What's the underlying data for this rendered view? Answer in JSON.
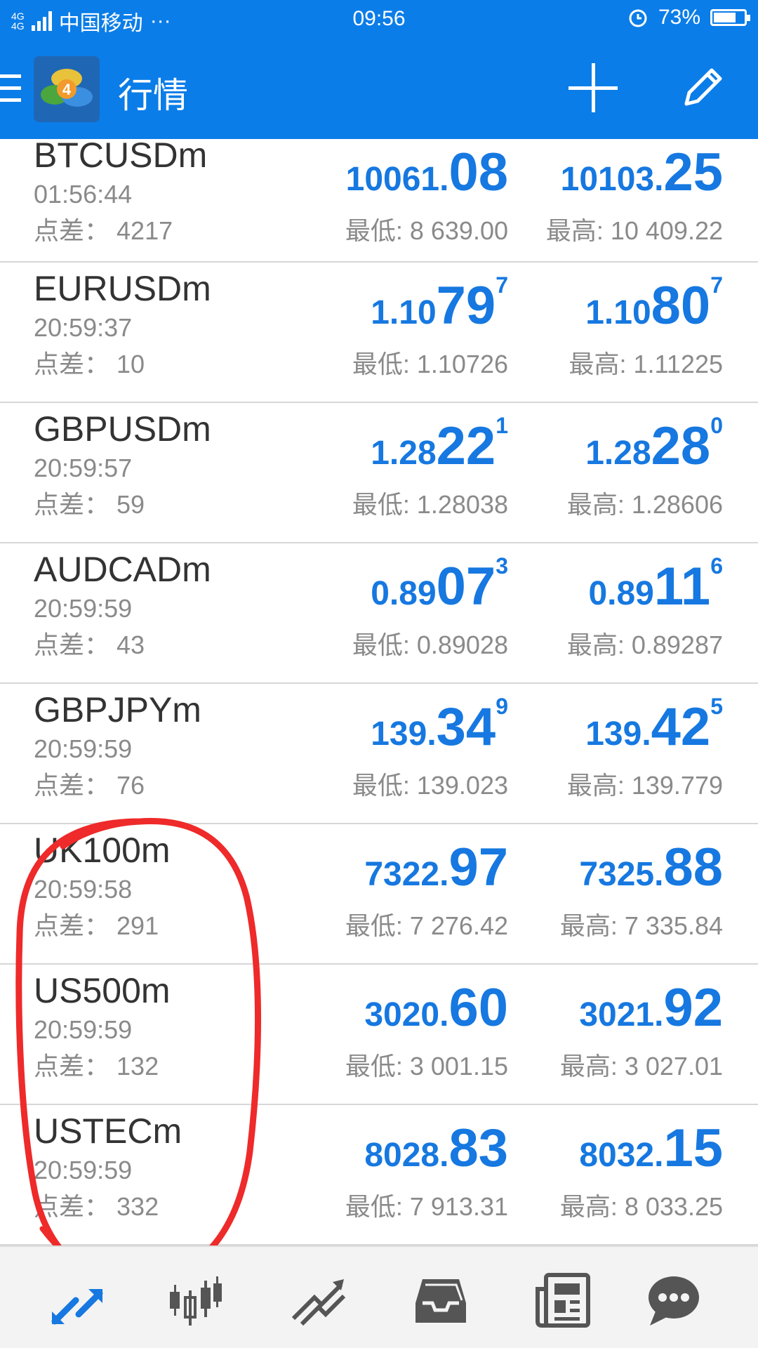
{
  "status_bar": {
    "network": "4G",
    "carrier": "中国移动",
    "more": "···",
    "time": "09:56",
    "battery_percent": "73%",
    "battery_level": 0.73
  },
  "toolbar": {
    "title": "行情",
    "logo_badge": "4"
  },
  "quotes": [
    {
      "symbol": "BTCUSDm",
      "time": "01:56:44",
      "spread_label": "点差：",
      "spread": "4217",
      "bid": {
        "small": "10061.",
        "big": "08",
        "sup": ""
      },
      "ask": {
        "small": "10103.",
        "big": "25",
        "sup": ""
      },
      "low": "最低: 8 639.00",
      "high": "最高: 10 409.22"
    },
    {
      "symbol": "EURUSDm",
      "time": "20:59:37",
      "spread_label": "点差：",
      "spread": "10",
      "bid": {
        "small": "1.10",
        "big": "79",
        "sup": "7"
      },
      "ask": {
        "small": "1.10",
        "big": "80",
        "sup": "7"
      },
      "low": "最低: 1.10726",
      "high": "最高: 1.11225"
    },
    {
      "symbol": "GBPUSDm",
      "time": "20:59:57",
      "spread_label": "点差：",
      "spread": "59",
      "bid": {
        "small": "1.28",
        "big": "22",
        "sup": "1"
      },
      "ask": {
        "small": "1.28",
        "big": "28",
        "sup": "0"
      },
      "low": "最低: 1.28038",
      "high": "最高: 1.28606"
    },
    {
      "symbol": "AUDCADm",
      "time": "20:59:59",
      "spread_label": "点差：",
      "spread": "43",
      "bid": {
        "small": "0.89",
        "big": "07",
        "sup": "3"
      },
      "ask": {
        "small": "0.89",
        "big": "11",
        "sup": "6"
      },
      "low": "最低: 0.89028",
      "high": "最高: 0.89287"
    },
    {
      "symbol": "GBPJPYm",
      "time": "20:59:59",
      "spread_label": "点差：",
      "spread": "76",
      "bid": {
        "small": "139.",
        "big": "34",
        "sup": "9"
      },
      "ask": {
        "small": "139.",
        "big": "42",
        "sup": "5"
      },
      "low": "最低: 139.023",
      "high": "最高: 139.779"
    },
    {
      "symbol": "UK100m",
      "time": "20:59:58",
      "spread_label": "点差：",
      "spread": "291",
      "bid": {
        "small": "7322.",
        "big": "97",
        "sup": ""
      },
      "ask": {
        "small": "7325.",
        "big": "88",
        "sup": ""
      },
      "low": "最低: 7 276.42",
      "high": "最高: 7 335.84"
    },
    {
      "symbol": "US500m",
      "time": "20:59:59",
      "spread_label": "点差：",
      "spread": "132",
      "bid": {
        "small": "3020.",
        "big": "60",
        "sup": ""
      },
      "ask": {
        "small": "3021.",
        "big": "92",
        "sup": ""
      },
      "low": "最低: 3 001.15",
      "high": "最高: 3 027.01"
    },
    {
      "symbol": "USTECm",
      "time": "20:59:59",
      "spread_label": "点差：",
      "spread": "332",
      "bid": {
        "small": "8028.",
        "big": "83",
        "sup": ""
      },
      "ask": {
        "small": "8032.",
        "big": "15",
        "sup": ""
      },
      "low": "最低: 7 913.31",
      "high": "最高: 8 033.25"
    }
  ],
  "bottom_nav": [
    {
      "icon": "quotes-arrows-icon",
      "active": true
    },
    {
      "icon": "candlestick-chart-icon",
      "active": false
    },
    {
      "icon": "trade-trend-icon",
      "active": false
    },
    {
      "icon": "history-inbox-icon",
      "active": false
    },
    {
      "icon": "news-icon",
      "active": false
    },
    {
      "icon": "chat-icon",
      "active": false
    }
  ],
  "colors": {
    "header_blue": "#0b7de8",
    "price_blue": "#1678e0",
    "annotation_red": "#ee2a2a",
    "nav_gray": "#555555"
  }
}
